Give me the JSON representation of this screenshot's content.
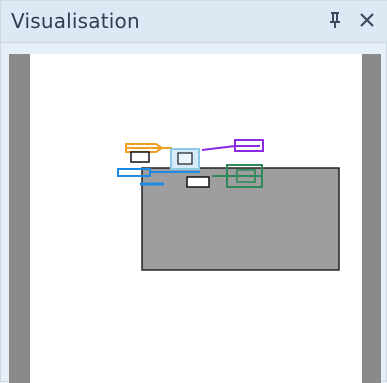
{
  "window": {
    "title": "Visualisation",
    "pin_icon": "pin-icon",
    "close_icon": "close-icon"
  },
  "colors": {
    "titlebar": "#dde8f5",
    "title_text": "#2f3d52",
    "side_gutter": "#8a8a8a",
    "canvas": "#ffffff",
    "rect_fill": "#9e9e9e",
    "orange": "#f0a020",
    "blue": "#1e88e5",
    "purple": "#8a2be2",
    "green": "#2e8b57",
    "light_blue": "#8ecae6"
  }
}
